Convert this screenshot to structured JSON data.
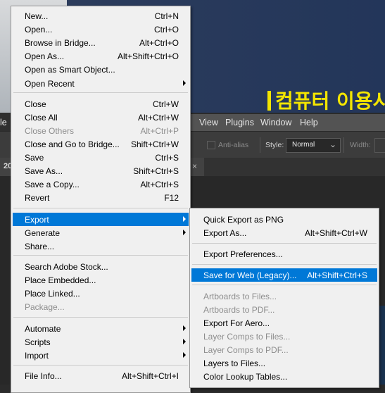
{
  "background": {
    "banner_text": "컴퓨터 이용시",
    "menubar": {
      "cut_label": "le",
      "items": [
        "View",
        "Plugins",
        "Window",
        "Help"
      ]
    },
    "options": {
      "anti_alias_label": "Anti-alias",
      "style_label": "Style:",
      "style_value": "Normal",
      "width_label": "Width:"
    },
    "document_tab": {
      "label": "20",
      "close_glyph": "×"
    }
  },
  "file_menu": {
    "items": [
      {
        "label": "New...",
        "shortcut": "Ctrl+N",
        "enabled": true
      },
      {
        "label": "Open...",
        "shortcut": "Ctrl+O",
        "enabled": true
      },
      {
        "label": "Browse in Bridge...",
        "shortcut": "Alt+Ctrl+O",
        "enabled": true
      },
      {
        "label": "Open As...",
        "shortcut": "Alt+Shift+Ctrl+O",
        "enabled": true
      },
      {
        "label": "Open as Smart Object...",
        "shortcut": "",
        "enabled": true
      },
      {
        "label": "Open Recent",
        "shortcut": "",
        "enabled": true,
        "submenu": true
      },
      {
        "label": "Close",
        "shortcut": "Ctrl+W",
        "enabled": true
      },
      {
        "label": "Close All",
        "shortcut": "Alt+Ctrl+W",
        "enabled": true
      },
      {
        "label": "Close Others",
        "shortcut": "Alt+Ctrl+P",
        "enabled": false
      },
      {
        "label": "Close and Go to Bridge...",
        "shortcut": "Shift+Ctrl+W",
        "enabled": true
      },
      {
        "label": "Save",
        "shortcut": "Ctrl+S",
        "enabled": true
      },
      {
        "label": "Save As...",
        "shortcut": "Shift+Ctrl+S",
        "enabled": true
      },
      {
        "label": "Save a Copy...",
        "shortcut": "Alt+Ctrl+S",
        "enabled": true
      },
      {
        "label": "Revert",
        "shortcut": "F12",
        "enabled": true
      },
      {
        "label": "Export",
        "shortcut": "",
        "enabled": true,
        "submenu": true,
        "highlighted": true
      },
      {
        "label": "Generate",
        "shortcut": "",
        "enabled": true,
        "submenu": true
      },
      {
        "label": "Share...",
        "shortcut": "",
        "enabled": true
      },
      {
        "label": "Search Adobe Stock...",
        "shortcut": "",
        "enabled": true
      },
      {
        "label": "Place Embedded...",
        "shortcut": "",
        "enabled": true
      },
      {
        "label": "Place Linked...",
        "shortcut": "",
        "enabled": true
      },
      {
        "label": "Package...",
        "shortcut": "",
        "enabled": false
      },
      {
        "label": "Automate",
        "shortcut": "",
        "enabled": true,
        "submenu": true
      },
      {
        "label": "Scripts",
        "shortcut": "",
        "enabled": true,
        "submenu": true
      },
      {
        "label": "Import",
        "shortcut": "",
        "enabled": true,
        "submenu": true
      },
      {
        "label": "File Info...",
        "shortcut": "Alt+Shift+Ctrl+I",
        "enabled": true
      }
    ]
  },
  "export_menu": {
    "items": [
      {
        "label": "Quick Export as PNG",
        "shortcut": "",
        "enabled": true
      },
      {
        "label": "Export As...",
        "shortcut": "Alt+Shift+Ctrl+W",
        "enabled": true
      },
      {
        "label": "Export Preferences...",
        "shortcut": "",
        "enabled": true
      },
      {
        "label": "Save for Web (Legacy)...",
        "shortcut": "Alt+Shift+Ctrl+S",
        "enabled": true,
        "highlighted": true
      },
      {
        "label": "Artboards to Files...",
        "shortcut": "",
        "enabled": false
      },
      {
        "label": "Artboards to PDF...",
        "shortcut": "",
        "enabled": false
      },
      {
        "label": "Export For Aero...",
        "shortcut": "",
        "enabled": true
      },
      {
        "label": "Layer Comps to Files...",
        "shortcut": "",
        "enabled": false
      },
      {
        "label": "Layer Comps to PDF...",
        "shortcut": "",
        "enabled": false
      },
      {
        "label": "Layers to Files...",
        "shortcut": "",
        "enabled": true
      },
      {
        "label": "Color Lookup Tables...",
        "shortcut": "",
        "enabled": true
      }
    ]
  },
  "colors": {
    "highlight": "#0078d7",
    "menu_bg": "#f0f0f0",
    "disabled_text": "#8d8d8d",
    "banner": "#f3e500"
  }
}
